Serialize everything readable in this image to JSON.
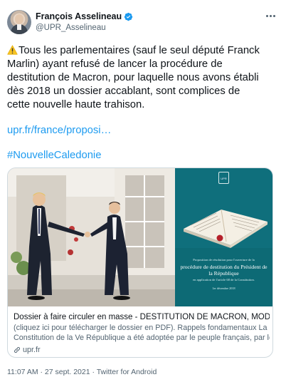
{
  "author": {
    "display_name": "François Asselineau",
    "handle": "@UPR_Asselineau",
    "verified": true
  },
  "tweet": {
    "text_lines": [
      "Tous les parlementaires (sauf le seul député Franck",
      "Marlin) ayant refusé de lancer la procédure de",
      "destitution de Macron, pour laquelle nous avons établi",
      "dès 2018 un dossier accablant, sont complices de",
      "cette nouvelle haute trahison."
    ],
    "link": "upr.fr/france/proposi…",
    "hashtag": "#NouvelleCaledonie"
  },
  "card": {
    "title": "Dossier à faire circuler en masse - DESTITUTION DE MACRON, MODE D'EMPL…",
    "description_lines": [
      "(cliquez ici pour télécharger le dossier en PDF). Rappels fondamentaux La",
      "Constitution de la Ve République a été adoptée par le peuple français, par le …"
    ],
    "domain": "upr.fr",
    "cover": {
      "logo_text": "UPR",
      "line1": "Proposition de résolution pour l'ouverture de la",
      "line2": "procédure de destitution du Président de la République",
      "line3": "en application de l'article 68 de la Constitution.",
      "line4": "1er décembre 2018"
    }
  },
  "footer": {
    "time": "11:07 AM",
    "separator": "·",
    "date": "27 sept. 2021",
    "source": "Twitter for Android",
    "full": "11:07 AM · 27 sept. 2021 · Twitter for Android"
  },
  "colors": {
    "link": "#1d9bf0",
    "secondary_text": "#536471",
    "cover_teal": "#0f6f7c"
  },
  "icons": {
    "warning": "warning-emoji-icon",
    "verified": "verified-badge-icon",
    "more": "more-options-icon",
    "link": "link-icon"
  }
}
